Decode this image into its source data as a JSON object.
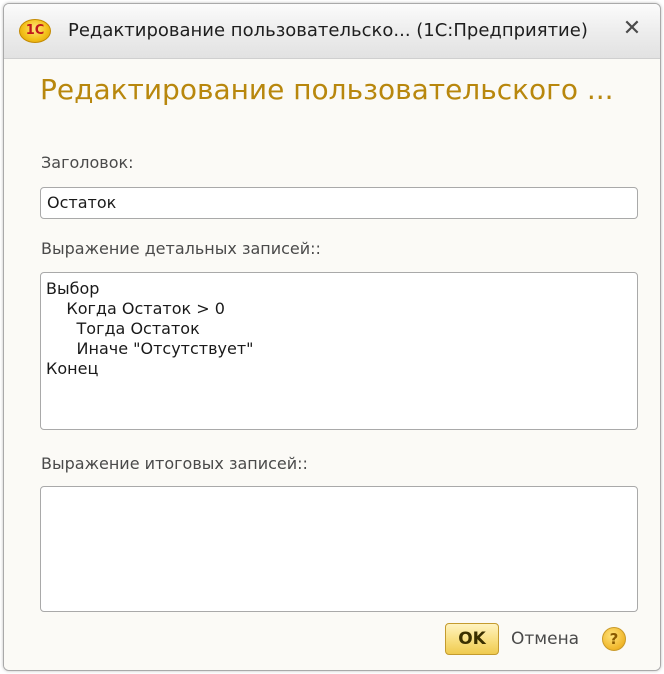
{
  "window": {
    "title": "Редактирование пользовательско...  (1С:Предприятие)",
    "logo_text": "1С",
    "close_symbol": "✕"
  },
  "form": {
    "heading": "Редактирование пользовательского ...",
    "caption_label": "Заголовок:",
    "caption_value": "Остаток",
    "detail_label": "Выражение детальных записей::",
    "detail_value": "Выбор\n    Когда Остаток > 0\n      Тогда Остаток\n      Иначе \"Отсутствует\"\nКонец",
    "total_label": "Выражение итоговых записей::",
    "total_value": ""
  },
  "footer": {
    "ok_label": "OK",
    "cancel_label": "Отмена",
    "help_symbol": "?"
  },
  "icons": {
    "logo": "1c-logo-icon",
    "close": "close-icon",
    "help": "help-icon"
  },
  "colors": {
    "heading": "#b8870d",
    "ok_button": "#f7dc79",
    "help_button": "#f0b62a"
  }
}
